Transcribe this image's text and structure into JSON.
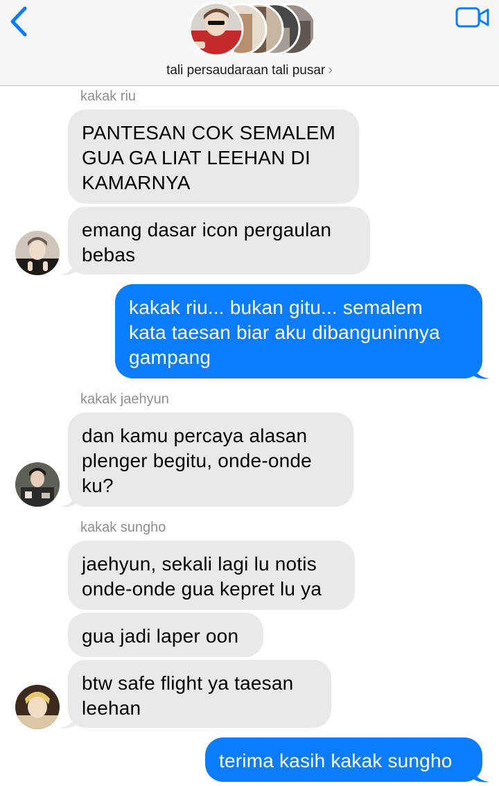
{
  "header": {
    "title": "tali persaudaraan tali pusar",
    "chevron": "›",
    "back_icon": "chevron-left-icon",
    "video_icon": "video-camera-icon",
    "accent": "#0b7cff"
  },
  "messages": [
    {
      "sender": "kakak riu",
      "text": "PANTESAN COK SEMALEM\nGUA GA LIAT LEEHAN DI\nKAMARNYA",
      "direction": "in"
    },
    {
      "text": "emang dasar icon pergaulan\nbebas",
      "direction": "in",
      "avatar": "riu"
    },
    {
      "text": "kakak riu... bukan gitu... semalem\nkata taesan biar aku dibanguninnya\ngampang",
      "direction": "out"
    },
    {
      "sender": "kakak jaehyun",
      "text": "dan kamu percaya alasan\nplenger begitu, onde-onde\nku?",
      "direction": "in",
      "avatar": "jaehyun"
    },
    {
      "sender": "kakak sungho",
      "text": "jaehyun, sekali lagi lu notis\nonde-onde gua kepret lu ya",
      "direction": "in"
    },
    {
      "text": "gua jadi laper oon",
      "direction": "in"
    },
    {
      "text": "btw safe flight ya taesan\nleehan",
      "direction": "in",
      "avatar": "sungho"
    },
    {
      "text": "terima kasih kakak sungho",
      "direction": "out"
    }
  ],
  "colors": {
    "incoming_bubble": "#e9e9eb",
    "outgoing_bubble": "#0b7cff",
    "sender_label": "#8e8e93"
  }
}
